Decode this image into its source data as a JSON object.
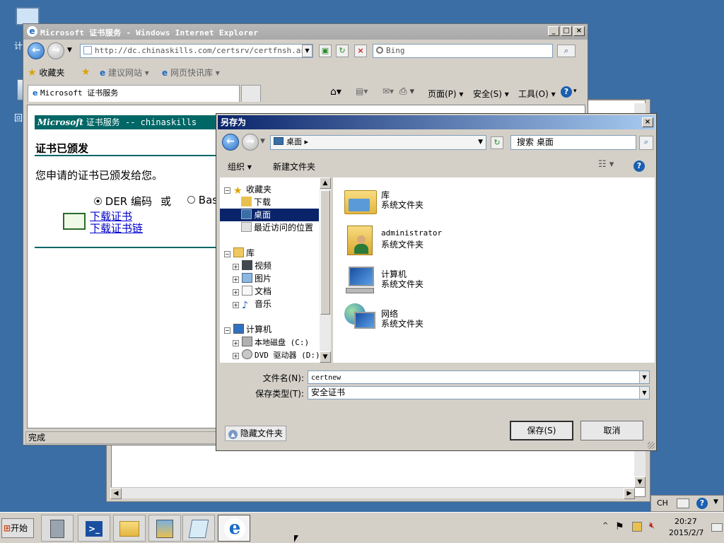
{
  "desktop": {
    "icons": [
      "计",
      "回"
    ]
  },
  "ie": {
    "title": "Microsoft 证书服务 - Windows Internet Explorer",
    "address": "http://dc.chinaskills.com/certsrv/certfnsh.asp",
    "address_host": "chinaskills",
    "search_placeholder": "Bing",
    "favorites_label": "收藏夹",
    "fav_links": [
      "建议网站",
      "网页快讯库"
    ],
    "tab_title": "Microsoft 证书服务",
    "command_bar": [
      "页面(P)",
      "安全(S)",
      "工具(O)"
    ],
    "page": {
      "header_brand": "Microsoft",
      "header_text": "证书服务  --  chinaskills",
      "heading": "证书已颁发",
      "message": "您申请的证书已颁发给您。",
      "encoding_der": "DER 编码",
      "encoding_or": "或",
      "encoding_base64": "Bas",
      "link_download_cert": "下载证书",
      "link_download_chain": "下载证书链"
    },
    "status": "完成"
  },
  "dialog": {
    "title": "另存为",
    "location": "桌面",
    "search_placeholder": "搜索 桌面",
    "toolbar": {
      "organize": "组织",
      "new_folder": "新建文件夹"
    },
    "tree": [
      {
        "label": "收藏夹",
        "icon": "star-icon",
        "level": 0,
        "expand": "−"
      },
      {
        "label": "下载",
        "icon": "downloads-icon",
        "level": 1
      },
      {
        "label": "桌面",
        "icon": "desktop-icon",
        "level": 1,
        "selected": true
      },
      {
        "label": "最近访问的位置",
        "icon": "recent-places-icon",
        "level": 1
      },
      {
        "label": "库",
        "icon": "library-icon",
        "level": 0,
        "expand": "−"
      },
      {
        "label": "视频",
        "icon": "video-icon",
        "level": 1,
        "expand": "+"
      },
      {
        "label": "图片",
        "icon": "pictures-icon",
        "level": 1,
        "expand": "+"
      },
      {
        "label": "文档",
        "icon": "documents-icon",
        "level": 1,
        "expand": "+"
      },
      {
        "label": "音乐",
        "icon": "music-icon",
        "level": 1,
        "expand": "+"
      },
      {
        "label": "计算机",
        "icon": "computer-icon",
        "level": 0,
        "expand": "−"
      },
      {
        "label": "本地磁盘 (C:)",
        "icon": "local-disk-icon",
        "level": 1,
        "expand": "+"
      },
      {
        "label": "DVD 驱动器 (D:)",
        "icon": "dvd-drive-icon",
        "level": 1,
        "expand": "+"
      }
    ],
    "files": [
      {
        "name": "库",
        "desc": "系统文件夹",
        "icon": "library-folder-icon"
      },
      {
        "name": "administrator",
        "desc": "系统文件夹",
        "icon": "user-folder-icon"
      },
      {
        "name": "计算机",
        "desc": "系统文件夹",
        "icon": "computer-icon"
      },
      {
        "name": "网络",
        "desc": "系统文件夹",
        "icon": "network-icon"
      }
    ],
    "filename_label": "文件名(N):",
    "filename_value": "certnew",
    "filetype_label": "保存类型(T):",
    "filetype_value": "安全证书",
    "hide_folders": "隐藏文件夹",
    "save": "保存(S)",
    "cancel": "取消"
  },
  "taskbar": {
    "start": "开始",
    "lang": "CH",
    "time": "20:27",
    "date": "2015/2/7"
  },
  "colors": {
    "desktop": "#3a6ea5",
    "dialog_title_start": "#0a246a",
    "header_bg": "#006666",
    "link": "#0000cc"
  }
}
